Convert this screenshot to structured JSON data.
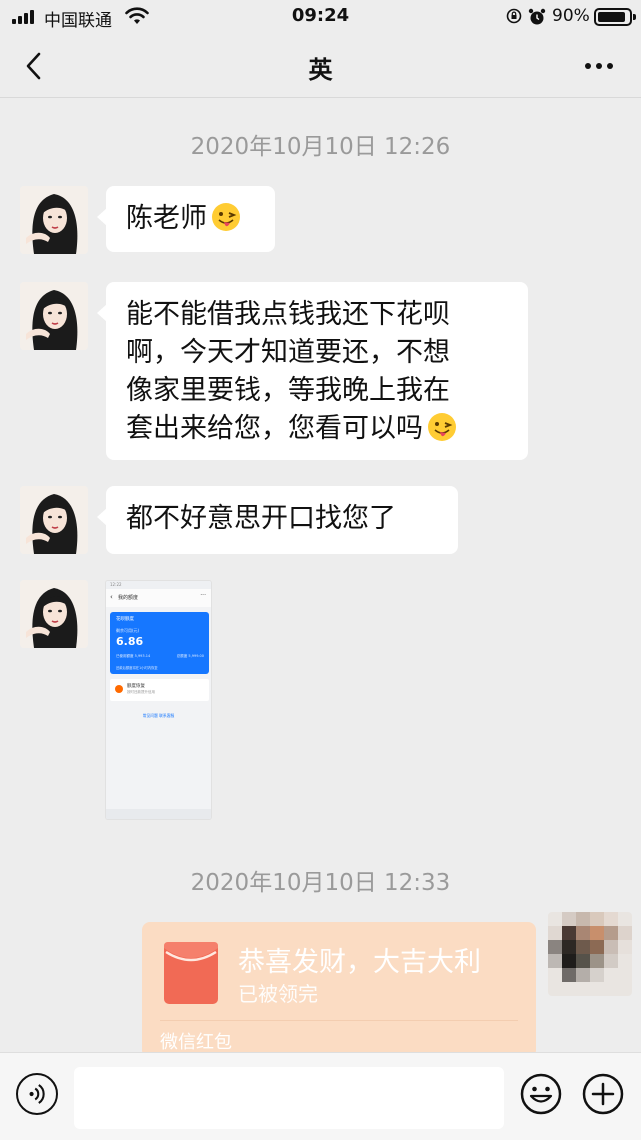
{
  "status_bar": {
    "carrier": "中国联通",
    "time": "09:24",
    "battery": "90%",
    "battery_level": 0.9,
    "icons": [
      "signal-icon",
      "wifi-icon",
      "orientation-lock-icon",
      "alarm-icon",
      "battery-icon"
    ]
  },
  "nav": {
    "title": "英",
    "back_icon": "chevron-left-icon",
    "more_icon": "more-dots-icon"
  },
  "chat": {
    "timestamp_1": "2020年10月10日 12:26",
    "messages": [
      {
        "sender": "contact",
        "text": "陈老师",
        "emoji": "tongue-wink-emoji"
      },
      {
        "sender": "contact",
        "lines": [
          "能不能借我点钱我还下花呗",
          "啊，今天才知道要还，不想",
          "像家里要钱，等我晚上我在",
          "套出来给您，您看可以吗"
        ],
        "emoji": "tongue-wink-emoji"
      },
      {
        "sender": "contact",
        "text": "都不好意思开口找您了"
      }
    ],
    "screenshot": {
      "status": "12:22",
      "page_title": "我的额度",
      "card_name": "花呗额度",
      "label": "剩余可用(元)",
      "amount": "6.86",
      "used": "已使用额度  5,993.14",
      "total": "总额度  5,999.00",
      "note": "还款后额度将在1小时内恢复",
      "item_name": "额度恢复",
      "item_desc": "按时还款提升信用",
      "links": "常见问题    联系客服"
    },
    "timestamp_2": "2020年10月10日 12:33",
    "red_packet": {
      "title": "恭喜发财，大吉大利",
      "status": "已被领完",
      "label": "微信红包",
      "icon": "red-envelope-icon"
    }
  },
  "input_bar": {
    "voice_icon": "voice-icon",
    "emoji_icon": "emoji-smile-icon",
    "plus_icon": "plus-circle-icon",
    "value": ""
  },
  "colors": {
    "background": "#ededed",
    "bubble": "#ffffff",
    "red_packet_faded": "#fbdcc3",
    "timestamp": "#9a9a9a"
  }
}
